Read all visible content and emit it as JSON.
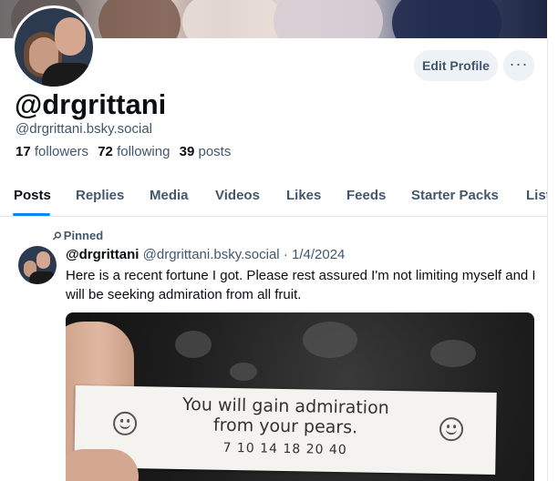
{
  "profile": {
    "display_handle": "@drgrittani",
    "full_handle": "@drgrittani.bsky.social",
    "followers_count": "17",
    "followers_label": "followers",
    "following_count": "72",
    "following_label": "following",
    "posts_count": "39",
    "posts_label": "posts"
  },
  "actions": {
    "edit_profile_label": "Edit Profile",
    "more_label": "···"
  },
  "tabs": [
    {
      "label": "Posts",
      "active": true
    },
    {
      "label": "Replies",
      "active": false
    },
    {
      "label": "Media",
      "active": false
    },
    {
      "label": "Videos",
      "active": false
    },
    {
      "label": "Likes",
      "active": false
    },
    {
      "label": "Feeds",
      "active": false
    },
    {
      "label": "Starter Packs",
      "active": false
    },
    {
      "label": "List",
      "active": false
    }
  ],
  "post": {
    "pinned_label": "Pinned",
    "author_name": "@drgrittani",
    "author_handle": "@drgrittani.bsky.social",
    "separator": "·",
    "date": "1/4/2024",
    "text": "Here is a recent fortune I got. Please rest assured I'm not limiting myself and I will be seeking admiration from all fruit.",
    "image": {
      "fortune_line1": "You will gain admiration",
      "fortune_line2": "from your pears.",
      "fortune_numbers": "7  10  14  18  20  40"
    }
  },
  "colors": {
    "accent": "#1083fe",
    "text_primary": "#0b0f14",
    "text_secondary": "#42576c",
    "button_bg": "#eef2f6"
  }
}
